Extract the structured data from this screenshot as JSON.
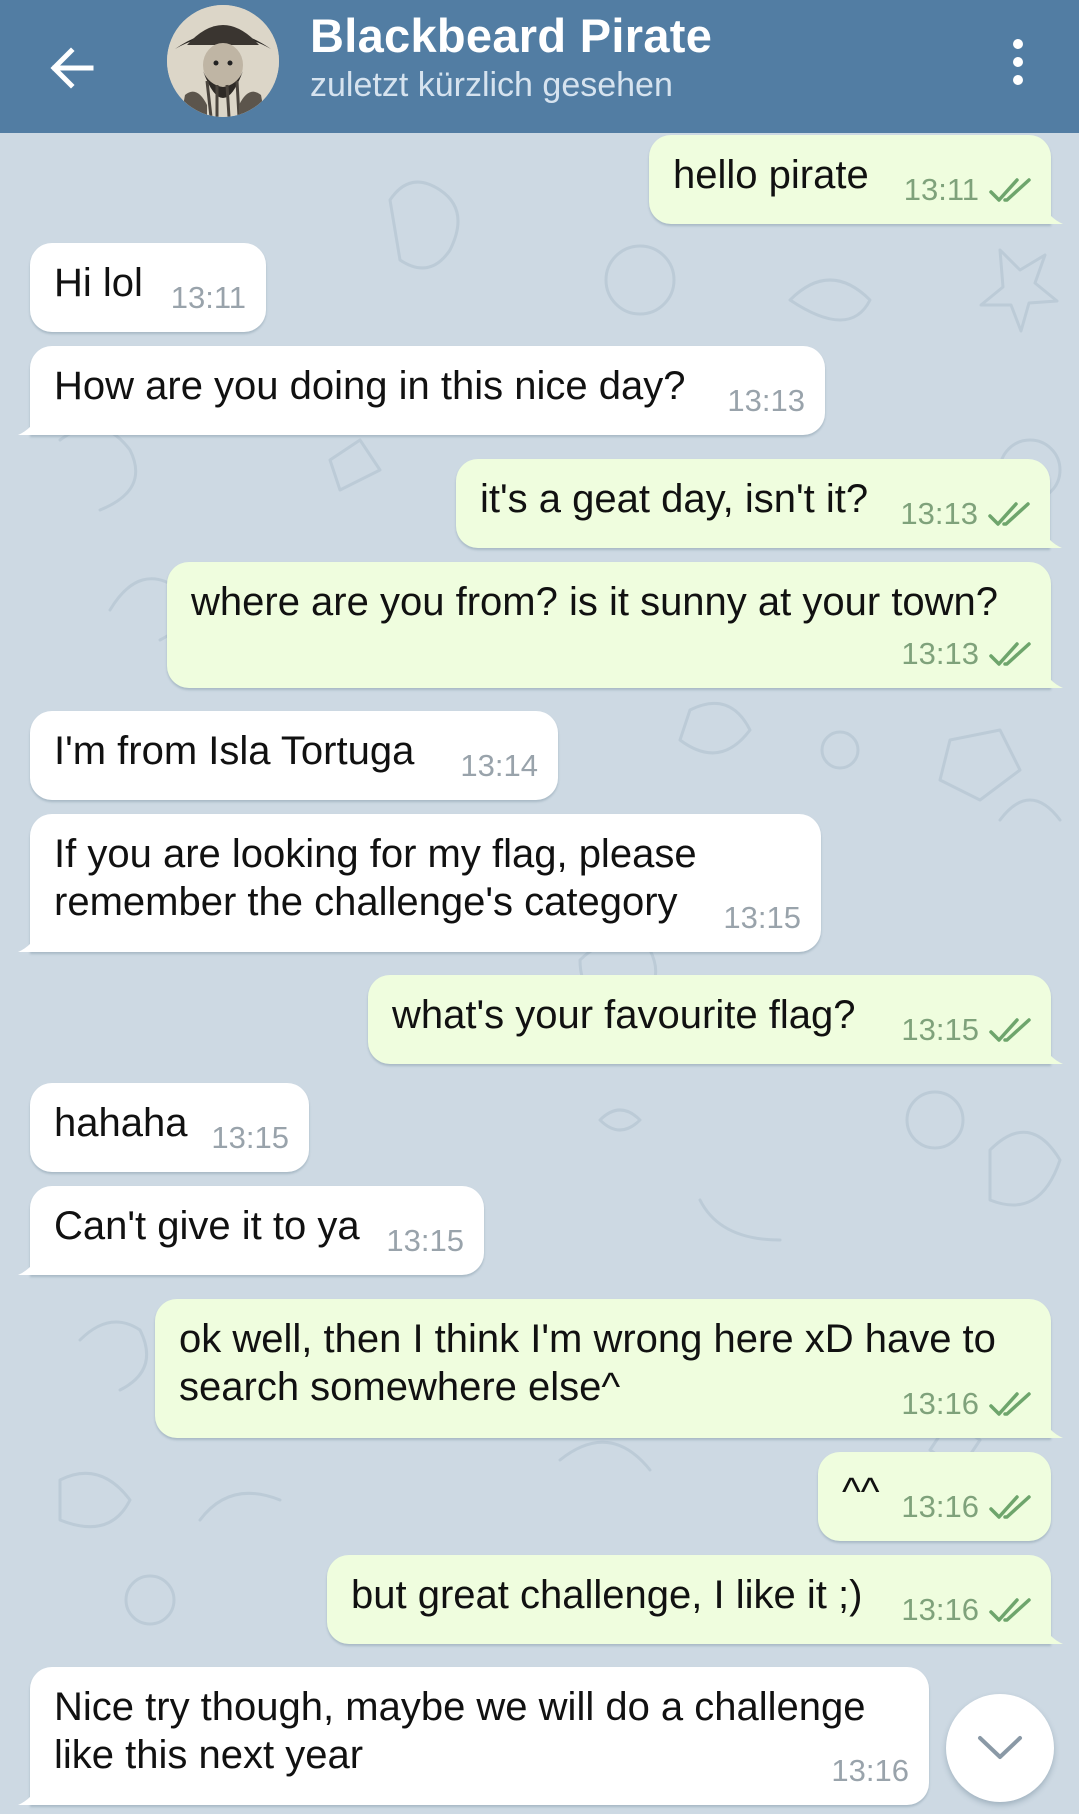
{
  "header": {
    "title": "Blackbeard Pirate",
    "status": "zuletzt kürzlich gesehen",
    "back_icon": "arrow-left-icon",
    "menu_icon": "more-vertical-icon"
  },
  "colors": {
    "header_bg": "#527da3",
    "chat_bg": "#cdd9e3",
    "incoming_bubble": "#ffffff",
    "outgoing_bubble": "#effdde",
    "outgoing_time": "#7fa27b",
    "incoming_time": "#99a3ab"
  },
  "messages": [
    {
      "direction": "out",
      "text": "hello pirate",
      "time": "13:11",
      "read": true
    },
    {
      "direction": "in",
      "text": "Hi lol",
      "time": "13:11"
    },
    {
      "direction": "in",
      "text": "How are you doing in this nice day?",
      "time": "13:13"
    },
    {
      "direction": "out",
      "text": "it's a geat day, isn't it?",
      "time": "13:13",
      "read": true
    },
    {
      "direction": "out",
      "text": "where are you from? is it sunny at your town?",
      "time": "13:13",
      "read": true
    },
    {
      "direction": "in",
      "text": "I'm from Isla Tortuga",
      "time": "13:14"
    },
    {
      "direction": "in",
      "text": "If you are looking for my flag, please\nremember the challenge's category",
      "time": "13:15"
    },
    {
      "direction": "out",
      "text": "what's your favourite flag?",
      "time": "13:15",
      "read": true
    },
    {
      "direction": "in",
      "text": "hahaha",
      "time": "13:15"
    },
    {
      "direction": "in",
      "text": "Can't give it to ya",
      "time": "13:15"
    },
    {
      "direction": "out",
      "text": "ok well, then I think I'm wrong here xD have to\nsearch somewhere else^",
      "time": "13:16",
      "read": true
    },
    {
      "direction": "out",
      "text": "^^",
      "time": "13:16",
      "read": true
    },
    {
      "direction": "out",
      "text": "but great challenge, I like it ;)",
      "time": "13:16",
      "read": true
    },
    {
      "direction": "in",
      "text": "Nice try though, maybe we will do a challenge\nlike this next year",
      "time": "13:16"
    }
  ],
  "scroll_down_icon": "chevron-down-icon"
}
